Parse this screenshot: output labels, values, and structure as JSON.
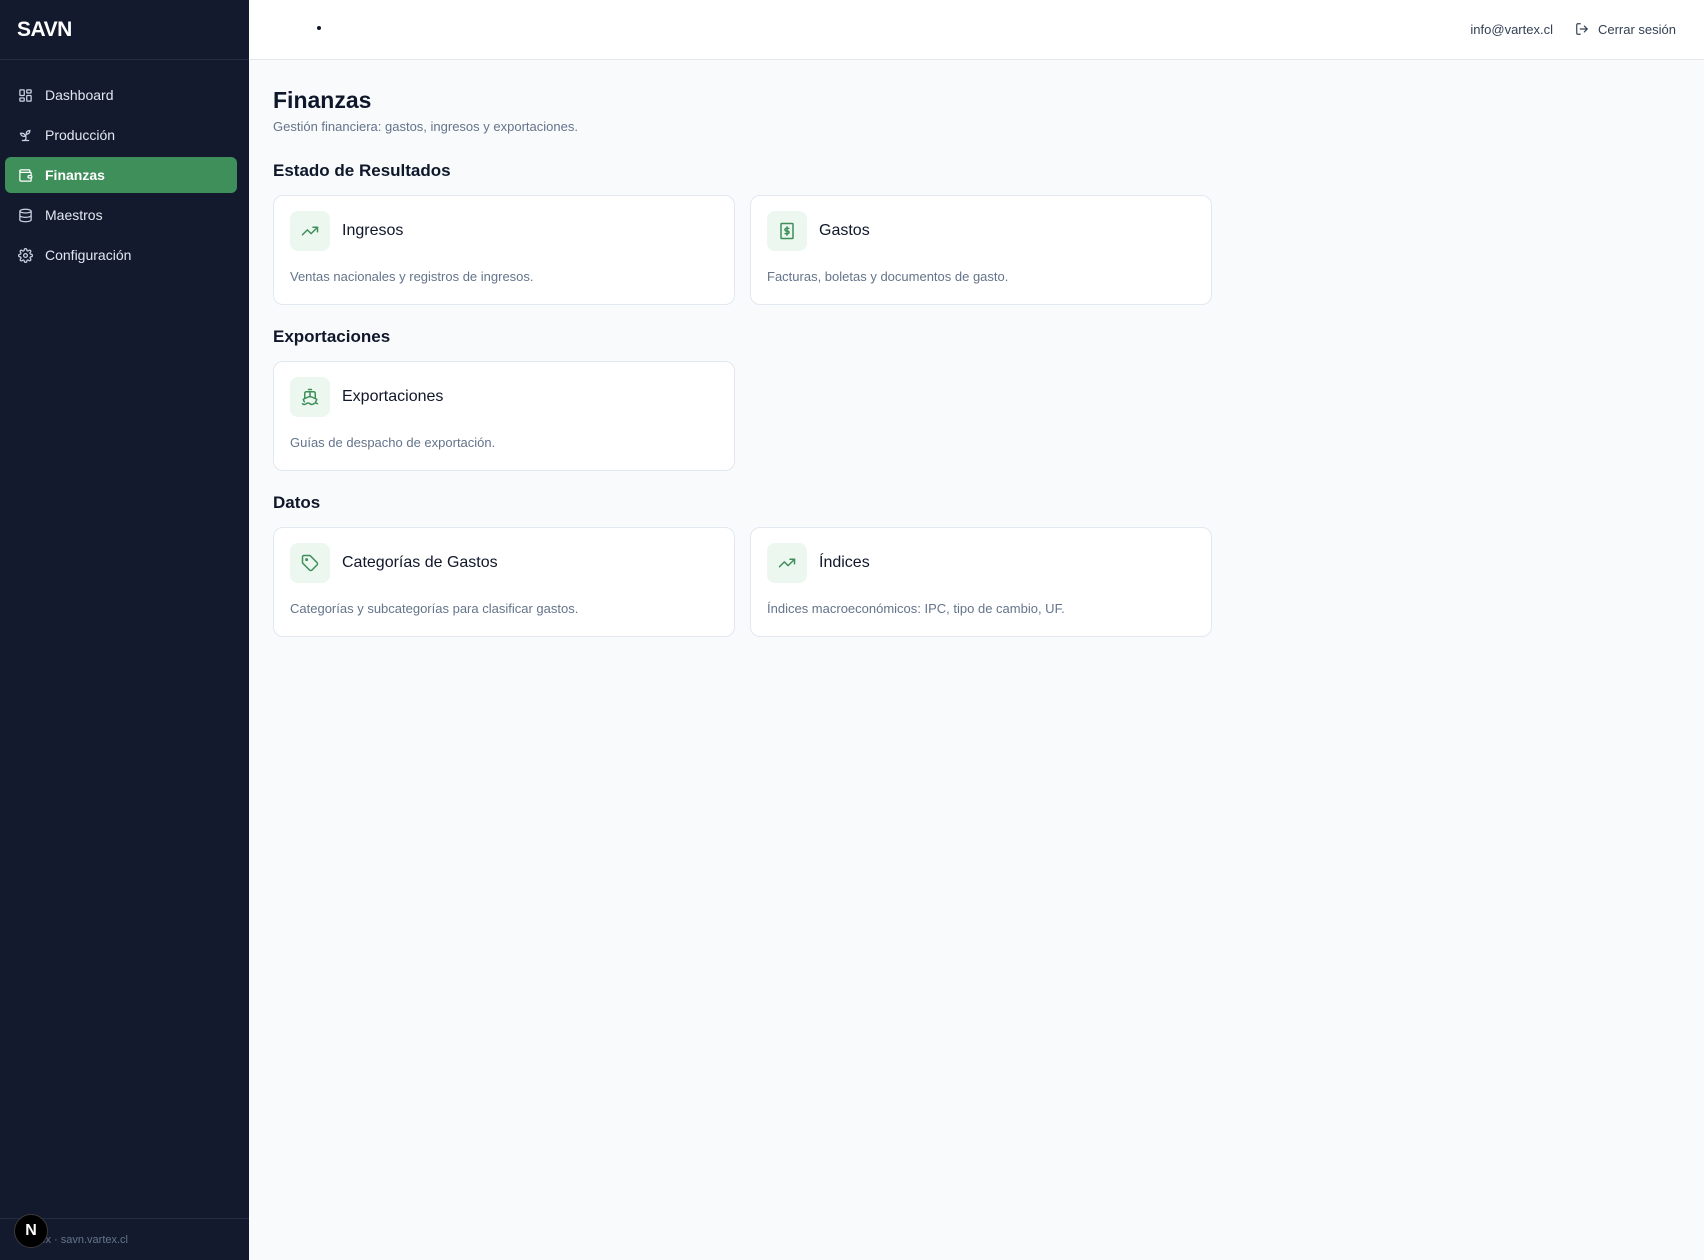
{
  "sidebar": {
    "brand": "SAVN",
    "items": [
      {
        "label": "Dashboard",
        "icon": "dashboard-icon"
      },
      {
        "label": "Producción",
        "icon": "sprout-icon"
      },
      {
        "label": "Finanzas",
        "icon": "wallet-icon",
        "active": true
      },
      {
        "label": "Maestros",
        "icon": "database-icon"
      },
      {
        "label": "Configuración",
        "icon": "gear-icon"
      }
    ],
    "footer": "Vartex · savn.vartex.cl",
    "badge": "N"
  },
  "topbar": {
    "email": "info@vartex.cl",
    "logout_label": "Cerrar sesión"
  },
  "page": {
    "title": "Finanzas",
    "subtitle": "Gestión financiera: gastos, ingresos y exportaciones."
  },
  "sections": [
    {
      "title": "Estado de Resultados",
      "cards": [
        {
          "title": "Ingresos",
          "desc": "Ventas nacionales y registros de ingresos.",
          "icon": "trending-up-icon"
        },
        {
          "title": "Gastos",
          "desc": "Facturas, boletas y documentos de gasto.",
          "icon": "receipt-icon"
        }
      ]
    },
    {
      "title": "Exportaciones",
      "cards": [
        {
          "title": "Exportaciones",
          "desc": "Guías de despacho de exportación.",
          "icon": "ship-icon"
        }
      ]
    },
    {
      "title": "Datos",
      "cards": [
        {
          "title": "Categorías de Gastos",
          "desc": "Categorías y subcategorías para clasificar gastos.",
          "icon": "tag-icon"
        },
        {
          "title": "Índices",
          "desc": "Índices macroeconómicos: IPC, tipo de cambio, UF.",
          "icon": "trending-up-icon"
        }
      ]
    }
  ],
  "colors": {
    "sidebar_bg": "#131a2e",
    "accent": "#3f8f5b",
    "icon_bg": "#ecf7f0",
    "icon_stroke": "#3f8f5b"
  }
}
